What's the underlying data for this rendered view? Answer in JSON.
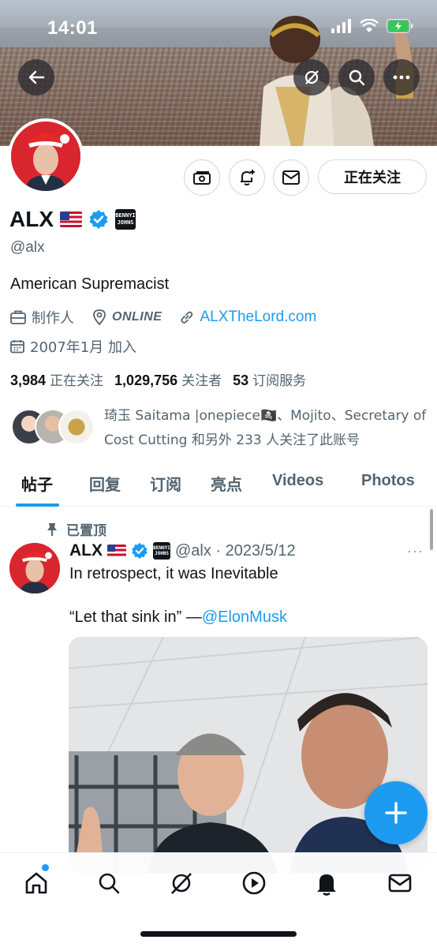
{
  "status_bar": {
    "time": "14:01"
  },
  "profile": {
    "name": "ALX",
    "handle": "@alx",
    "bio": "American Supremacist",
    "profession": "制作人",
    "location": "ONLINE",
    "website": "ALXTheLord.com",
    "joined": "2007年1月 加入",
    "follow_button": "正在关注",
    "badge_text": "BENNYI JOHNS",
    "stats": {
      "following_count": "3,984",
      "following_label": "正在关注",
      "followers_count": "1,029,756",
      "followers_label": "关注者",
      "subscriptions_count": "53",
      "subscriptions_label": "订阅服务"
    },
    "known_followers_text": "琦玉 Saitama |onepiece🏴‍☠️、Mojito、Secretary of Cost Cutting 和另外 233 人关注了此账号"
  },
  "tabs": [
    "帖子",
    "回复",
    "订阅",
    "亮点",
    "Videos",
    "Photos"
  ],
  "pinned_post": {
    "pinned_label": "已置顶",
    "author": "ALX",
    "meta": "@alx · 2023/5/12",
    "line1": "In retrospect, it was Inevitable",
    "line2_prefix": "“Let that sink in” —",
    "mention": "@ElonMusk",
    "more": "···"
  },
  "colors": {
    "accent": "#1d9bf0",
    "text": "#0f1419",
    "secondary": "#536471",
    "avatar_bg": "#d9262e"
  }
}
